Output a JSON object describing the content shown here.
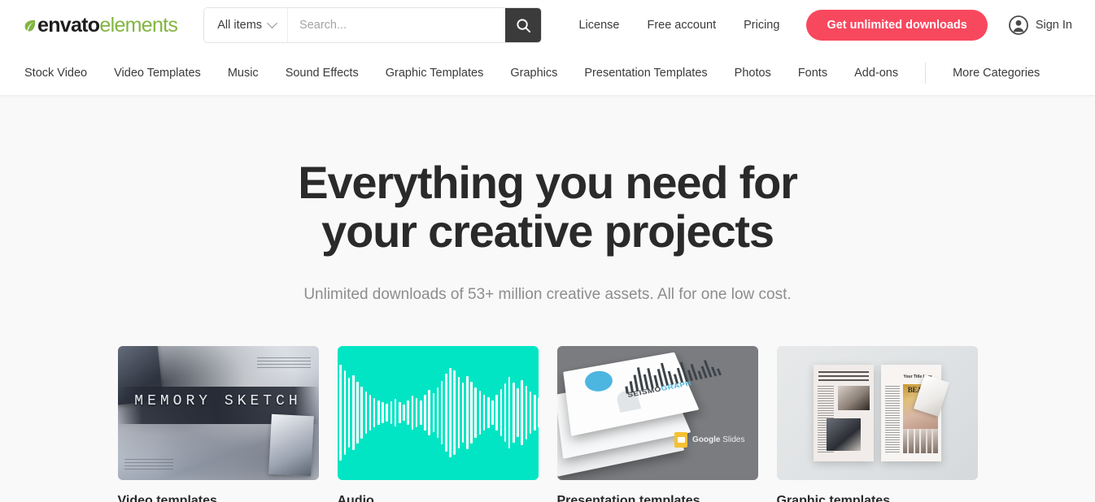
{
  "header": {
    "logo": {
      "part1": "envato",
      "part2": "elements",
      "leaf_icon": "leaf-icon",
      "green": "#82b541"
    },
    "search": {
      "category_label": "All items",
      "category_icon": "chevron-down-icon",
      "placeholder": "Search...",
      "value": "",
      "button_icon": "search-icon"
    },
    "links": [
      {
        "label": "License"
      },
      {
        "label": "Free account"
      },
      {
        "label": "Pricing"
      }
    ],
    "cta": {
      "label": "Get unlimited downloads",
      "color": "#f8485e"
    },
    "signin": {
      "label": "Sign In",
      "icon": "user-avatar-icon"
    }
  },
  "categories": [
    {
      "label": "Stock Video"
    },
    {
      "label": "Video Templates"
    },
    {
      "label": "Music"
    },
    {
      "label": "Sound Effects"
    },
    {
      "label": "Graphic Templates"
    },
    {
      "label": "Graphics"
    },
    {
      "label": "Presentation Templates"
    },
    {
      "label": "Photos"
    },
    {
      "label": "Fonts"
    },
    {
      "label": "Add-ons"
    }
  ],
  "categories_more": {
    "label": "More Categories"
  },
  "hero": {
    "title_line1": "Everything you need for",
    "title_line2": "your creative projects",
    "subtitle": "Unlimited downloads of 53+ million creative assets. All for one low cost."
  },
  "cards": [
    {
      "label": "Video templates",
      "thumb_kind": "video-template-thumbnail",
      "thumb_title": "MEMORY SKETCH"
    },
    {
      "label": "Audio",
      "thumb_kind": "audio-waveform-thumbnail",
      "accent": "#02e5c4"
    },
    {
      "label": "Presentation templates",
      "thumb_kind": "presentation-slides-thumbnail",
      "thumb_title_a": "SEISMO",
      "thumb_title_b": "GRAPH",
      "badge_brand": "Google",
      "badge_product": "Slides"
    },
    {
      "label": "Graphic templates",
      "thumb_kind": "magazine-spread-thumbnail",
      "mag_heading": "BEAUTY",
      "mag_subheading": "Your Title Here"
    }
  ]
}
